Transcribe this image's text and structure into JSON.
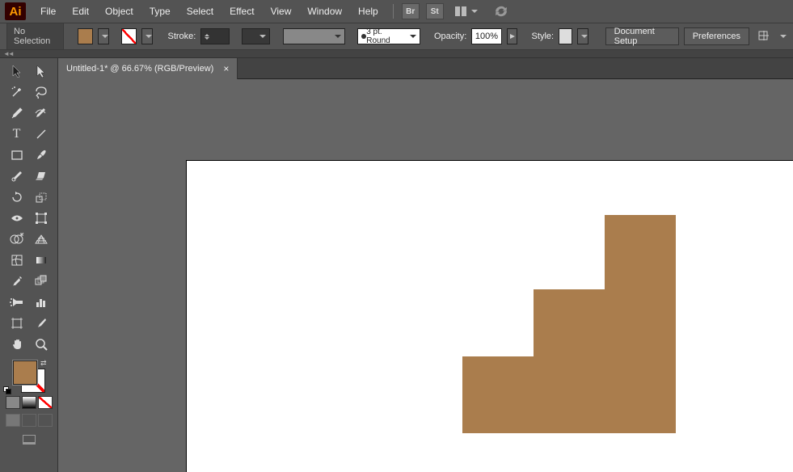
{
  "app": {
    "logo": "Ai"
  },
  "menu": {
    "file": "File",
    "edit": "Edit",
    "object": "Object",
    "type": "Type",
    "select": "Select",
    "effect": "Effect",
    "view": "View",
    "window": "Window",
    "help": "Help"
  },
  "topbuttons": {
    "br": "Br",
    "st": "St"
  },
  "control": {
    "noselection": "No Selection",
    "stroke_label": "Stroke:",
    "profile_label": "3 pt. Round",
    "opacity_label": "Opacity:",
    "opacity_value": "100%",
    "style_label": "Style:",
    "doc_setup": "Document Setup",
    "preferences": "Preferences"
  },
  "doc": {
    "tab_title": "Untitled-1* @ 66.67% (RGB/Preview)",
    "tab_close": "×"
  },
  "colors": {
    "fill": "#aa7d4d",
    "stroke": "none"
  },
  "tools": [
    {
      "name": "selection-tool",
      "icon": "cursor-black"
    },
    {
      "name": "direct-selection-tool",
      "icon": "cursor-white"
    },
    {
      "name": "magic-wand-tool",
      "icon": "wand"
    },
    {
      "name": "lasso-tool",
      "icon": "lasso"
    },
    {
      "name": "pen-tool",
      "icon": "pen"
    },
    {
      "name": "curvature-tool",
      "icon": "curve-pen"
    },
    {
      "name": "type-tool",
      "icon": "T"
    },
    {
      "name": "line-tool",
      "icon": "line"
    },
    {
      "name": "rectangle-tool",
      "icon": "rect"
    },
    {
      "name": "paintbrush-tool",
      "icon": "brush"
    },
    {
      "name": "shaper-tool",
      "icon": "shaper"
    },
    {
      "name": "eraser-tool",
      "icon": "eraser"
    },
    {
      "name": "rotate-tool",
      "icon": "rotate"
    },
    {
      "name": "scale-tool",
      "icon": "scale"
    },
    {
      "name": "width-tool",
      "icon": "width"
    },
    {
      "name": "free-transform-tool",
      "icon": "freetransform"
    },
    {
      "name": "shape-builder-tool",
      "icon": "shapebuilder"
    },
    {
      "name": "perspective-grid-tool",
      "icon": "perspective"
    },
    {
      "name": "mesh-tool",
      "icon": "mesh"
    },
    {
      "name": "gradient-tool",
      "icon": "gradient"
    },
    {
      "name": "eyedropper-tool",
      "icon": "eyedropper"
    },
    {
      "name": "blend-tool",
      "icon": "blend"
    },
    {
      "name": "symbol-sprayer-tool",
      "icon": "spray"
    },
    {
      "name": "column-graph-tool",
      "icon": "graph"
    },
    {
      "name": "artboard-tool",
      "icon": "artboard"
    },
    {
      "name": "slice-tool",
      "icon": "slice"
    },
    {
      "name": "hand-tool",
      "icon": "hand"
    },
    {
      "name": "zoom-tool",
      "icon": "zoom"
    }
  ]
}
